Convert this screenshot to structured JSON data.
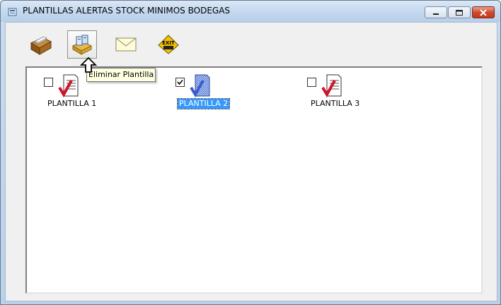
{
  "window": {
    "title": "PLANTILLAS ALERTAS STOCK MINIMOS BODEGAS"
  },
  "toolbar": {
    "buttons": [
      {
        "name": "archive-button",
        "icon": "card-file-icon"
      },
      {
        "name": "delete-template-button",
        "icon": "delete-template-icon"
      },
      {
        "name": "email-button",
        "icon": "envelope-icon"
      },
      {
        "name": "exit-button",
        "icon": "exit-sign-icon",
        "icon_text": "EXIT"
      }
    ],
    "tooltip": "Eliminar Plantilla"
  },
  "templates": [
    {
      "label": "PLANTILLA 1",
      "checked": false,
      "selected": false
    },
    {
      "label": "PLANTILLA 2",
      "checked": true,
      "selected": true
    },
    {
      "label": "PLANTILLA 3",
      "checked": false,
      "selected": false
    }
  ],
  "colors": {
    "selection": "#3399ff",
    "check_red": "#d0142a",
    "check_blue": "#3a5ccc"
  }
}
